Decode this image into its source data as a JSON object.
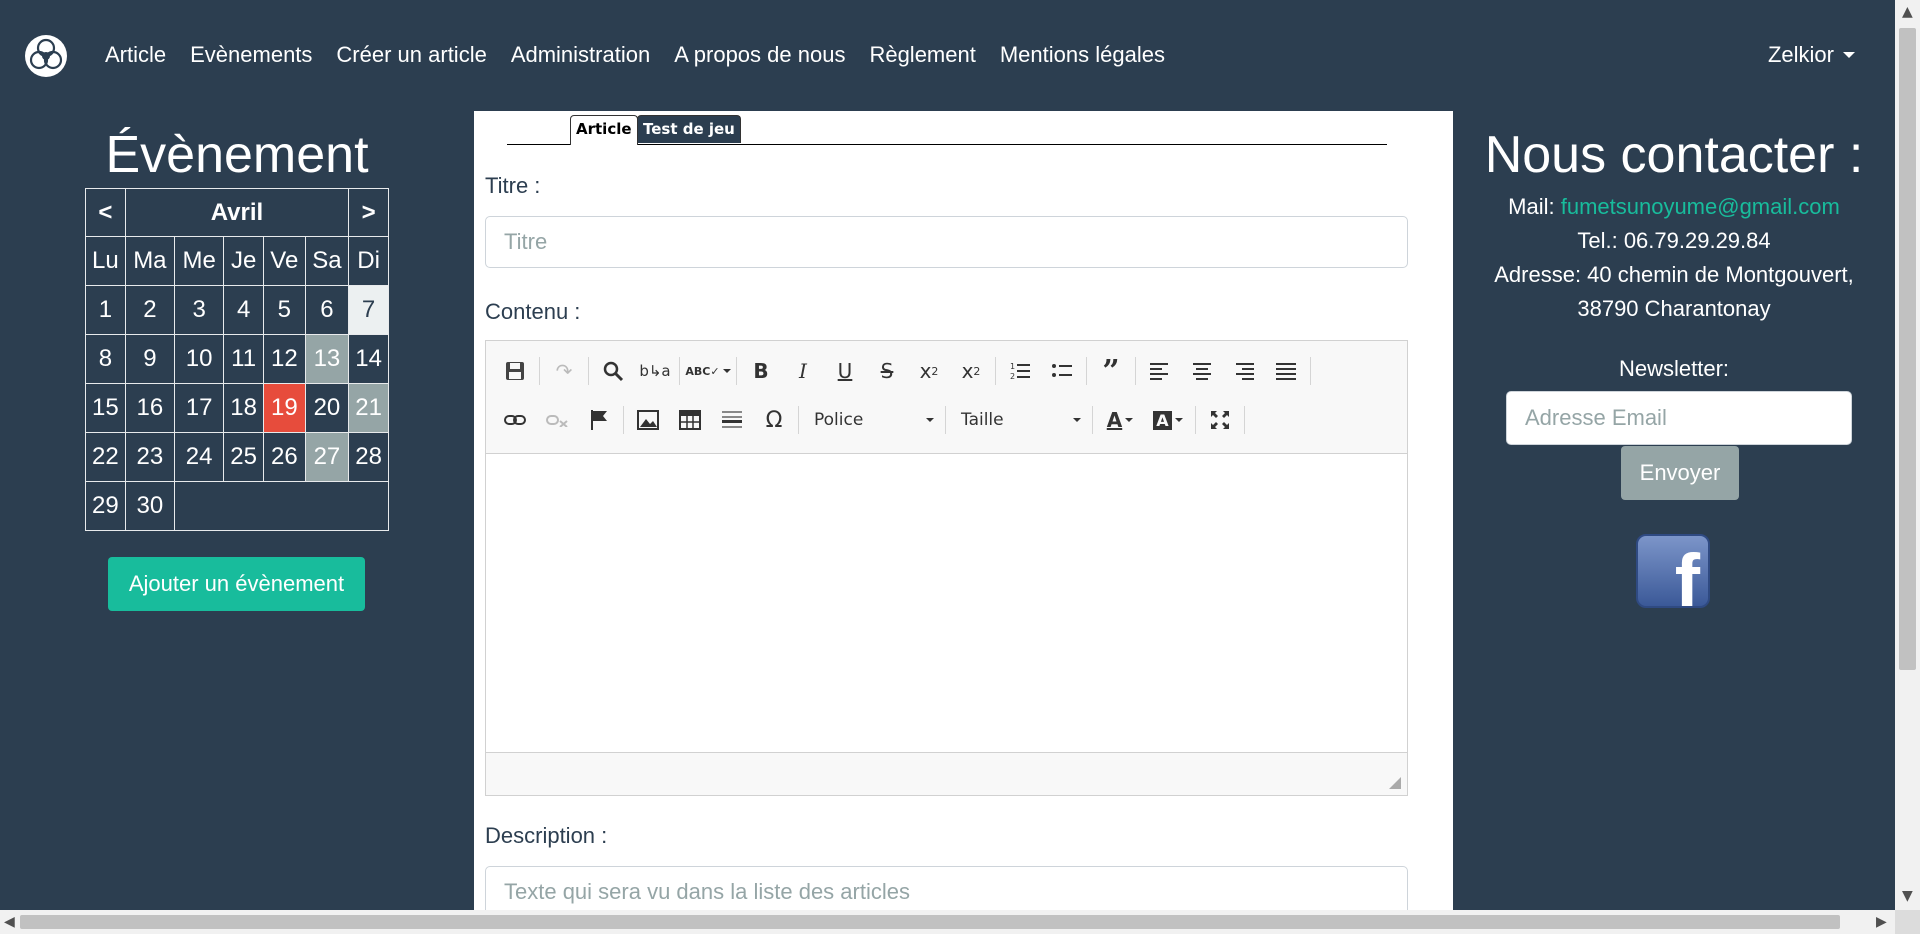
{
  "nav": {
    "links": [
      "Article",
      "Evènements",
      "Créer un article",
      "Administration",
      "A propos de nous",
      "Règlement",
      "Mentions légales"
    ],
    "user": "Zelkior"
  },
  "events": {
    "title": "Évènement",
    "calendar": {
      "prev": "<",
      "month": "Avril",
      "next": ">",
      "weekdays": [
        "Lu",
        "Ma",
        "Me",
        "Je",
        "Ve",
        "Sa",
        "Di"
      ],
      "weeks": [
        [
          "1",
          "2",
          "3",
          "4",
          "5",
          "6",
          "7"
        ],
        [
          "8",
          "9",
          "10",
          "11",
          "12",
          "13",
          "14"
        ],
        [
          "15",
          "16",
          "17",
          "18",
          "19",
          "20",
          "21"
        ],
        [
          "22",
          "23",
          "24",
          "25",
          "26",
          "27",
          "28"
        ],
        [
          "29",
          "30",
          "",
          "",
          "",
          "",
          ""
        ]
      ],
      "today": "7",
      "event_days": [
        "13",
        "21",
        "27"
      ],
      "highlight_day": "19"
    },
    "add_button": "Ajouter un évènement"
  },
  "form": {
    "tabs": [
      "Article",
      "Test de jeu"
    ],
    "active_tab": "Article",
    "title_label": "Titre :",
    "title_placeholder": "Titre",
    "content_label": "Contenu :",
    "font_combo": "Police",
    "size_combo": "Taille",
    "description_label": "Description :",
    "description_placeholder": "Texte qui sera vu dans la liste des articles"
  },
  "contact": {
    "title": "Nous contacter :",
    "mail_label": "Mail: ",
    "mail": "fumetsunoyume@gmail.com",
    "tel": "Tel.: 06.79.29.29.84",
    "address_line1": "Adresse: 40 chemin de Montgouvert,",
    "address_line2": "38790 Charantonay",
    "newsletter_label": "Newsletter:",
    "email_placeholder": "Adresse Email",
    "send_button": "Envoyer"
  },
  "colors": {
    "background": "#2c3e50",
    "accent": "#18bc9c",
    "event_grey": "#95a5a6",
    "event_red": "#e74c3c"
  },
  "icons": [
    "logo-icon",
    "facebook-icon"
  ]
}
